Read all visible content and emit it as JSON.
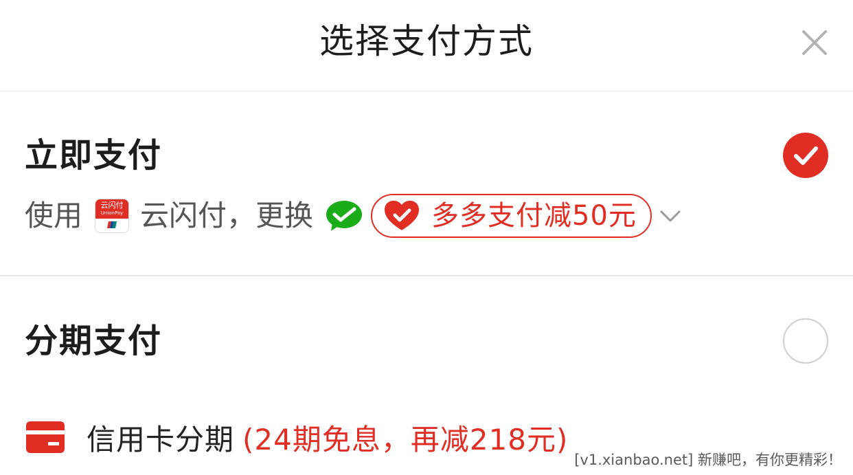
{
  "header": {
    "title": "选择支付方式",
    "close_icon": "close-icon"
  },
  "instant_pay": {
    "title": "立即支付",
    "selected": true,
    "use_prefix": "使用",
    "method_icon": "unionpay-icon",
    "method_icon_text": "云闪付",
    "method_icon_subtext": "UnionPay",
    "method_name": "云闪付，更换",
    "alt_icon": "wechat-pay-icon",
    "promo_icon": "heart-shield-check-icon",
    "promo_text": "多多支付减50元",
    "expand_icon": "chevron-down-icon"
  },
  "installment": {
    "title": "分期支付",
    "selected": false,
    "credit_icon": "credit-card-icon",
    "credit_label": "信用卡分期",
    "credit_promo": "(24期免息，再减218元)"
  },
  "watermark": "[v1.xianbao.net] 新赚吧，有你更精彩！",
  "colors": {
    "accent": "#e02e24",
    "wechat": "#1aad19",
    "text": "#1c1c1c",
    "muted": "#555555"
  }
}
